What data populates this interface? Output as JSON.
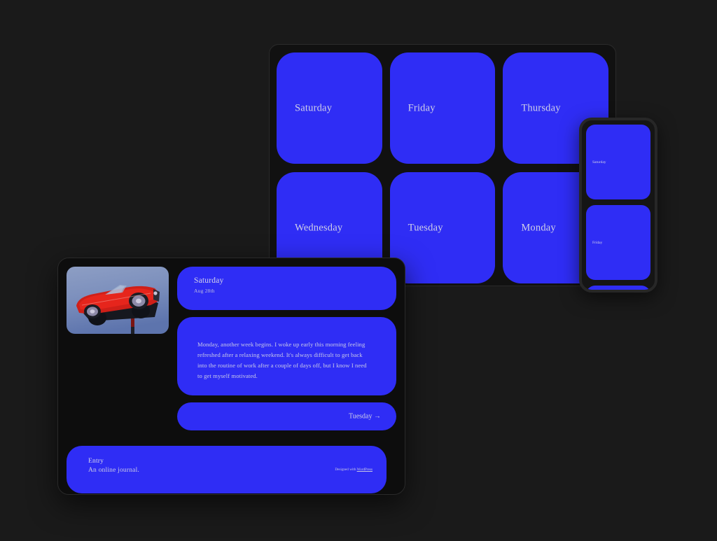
{
  "theme": {
    "accent_blue": "#2f2df5",
    "background": "#1a1a1a",
    "panel_dark": "#111111",
    "text_on_blue": "#cfcfe8"
  },
  "desktop_preview": {
    "days": [
      {
        "label": "Saturday"
      },
      {
        "label": "Friday"
      },
      {
        "label": "Thursday"
      },
      {
        "label": "Wednesday"
      },
      {
        "label": "Tuesday"
      },
      {
        "label": "Monday"
      }
    ]
  },
  "mobile_preview": {
    "days": [
      {
        "label": "Saturday"
      },
      {
        "label": "Friday"
      },
      {
        "label": ""
      }
    ]
  },
  "entry_detail": {
    "featured_image": {
      "alt": "red-convertible-car-on-pole"
    },
    "header": {
      "title": "Saturday",
      "date": "Aug 28th"
    },
    "body": "Monday, another week begins. I woke up early this morning feeling refreshed after a relaxing weekend. It's always difficult to get back into the routine of work after a couple of days off, but I know I need to get myself motivated.",
    "next_link": "Tuesday →",
    "footer": {
      "site_title": "Entry",
      "tagline": "An online journal.",
      "credit_prefix": "Designed with ",
      "credit_link": "WordPress"
    }
  }
}
